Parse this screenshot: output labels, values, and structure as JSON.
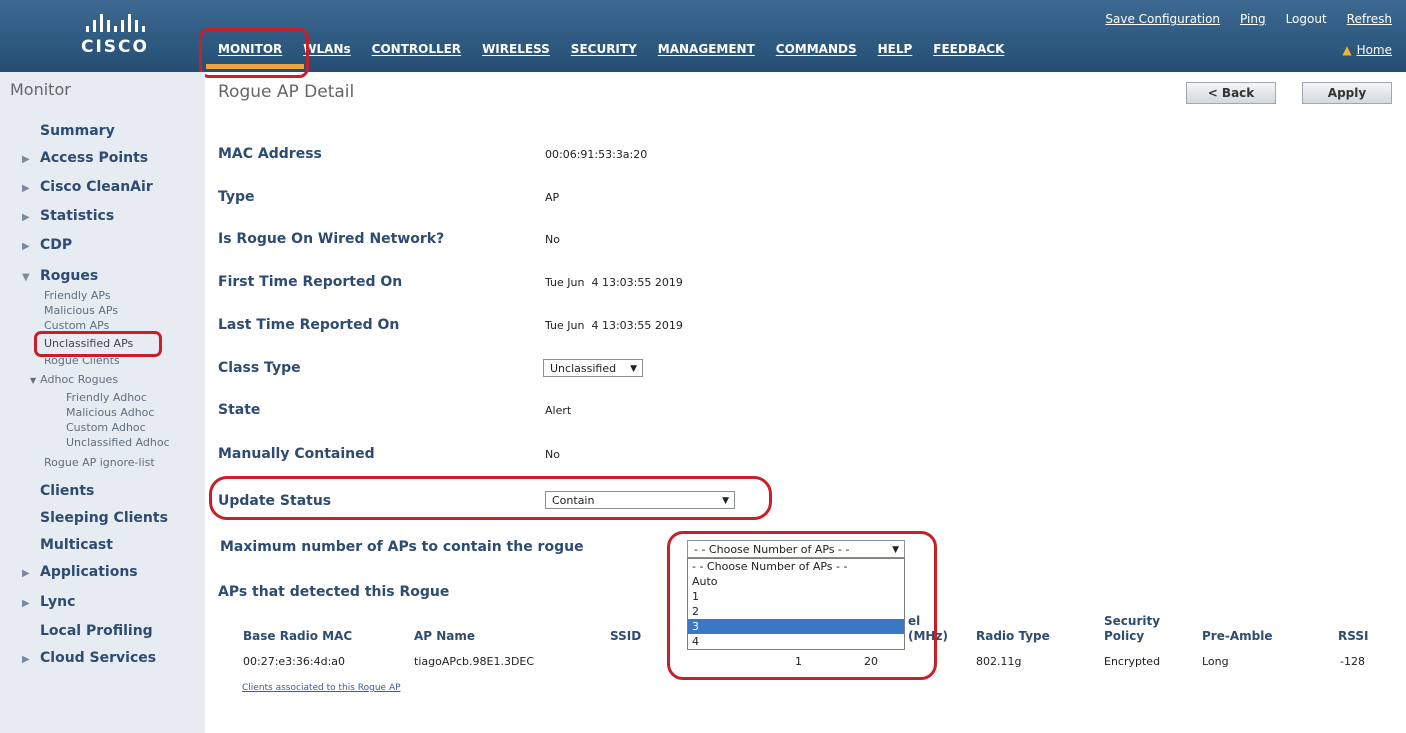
{
  "brand": {
    "logo_text": "CISCO"
  },
  "top_links": {
    "save": "Save Configuration",
    "ping": "Ping",
    "logout": "Logout",
    "refresh": "Refresh",
    "home": "Home"
  },
  "nav": [
    "MONITOR",
    "WLANs",
    "CONTROLLER",
    "WIRELESS",
    "SECURITY",
    "MANAGEMENT",
    "COMMANDS",
    "HELP",
    "FEEDBACK"
  ],
  "sidebar": {
    "title": "Monitor",
    "items": {
      "summary": "Summary",
      "access_points": "Access Points",
      "cleanair": "Cisco CleanAir",
      "statistics": "Statistics",
      "cdp": "CDP",
      "rogues": "Rogues",
      "friendly_aps": "Friendly APs",
      "malicious_aps": "Malicious APs",
      "custom_aps": "Custom APs",
      "unclassified_aps": "Unclassified APs",
      "rogue_clients": "Rogue Clients",
      "adhoc_rogues": "Adhoc Rogues",
      "friendly_adhoc": "Friendly Adhoc",
      "malicious_adhoc": "Malicious Adhoc",
      "custom_adhoc": "Custom Adhoc",
      "unclassified_adhoc": "Unclassified Adhoc",
      "ignore_list": "Rogue AP ignore-list",
      "clients": "Clients",
      "sleeping_clients": "Sleeping Clients",
      "multicast": "Multicast",
      "applications": "Applications",
      "lync": "Lync",
      "local_profiling": "Local Profiling",
      "cloud_services": "Cloud Services"
    }
  },
  "page": {
    "title": "Rogue AP Detail",
    "back_button": "< Back",
    "apply_button": "Apply"
  },
  "fields": {
    "mac_label": "MAC Address",
    "mac_value": "00:06:91:53:3a:20",
    "type_label": "Type",
    "type_value": "AP",
    "wired_label": "Is Rogue On Wired Network?",
    "wired_value": "No",
    "first_label": "First Time Reported On",
    "first_value": "Tue Jun  4 13:03:55 2019",
    "last_label": "Last Time Reported On",
    "last_value": "Tue Jun  4 13:03:55 2019",
    "class_label": "Class Type",
    "class_value": "Unclassified",
    "state_label": "State",
    "state_value": "Alert",
    "contained_label": "Manually Contained",
    "contained_value": "No",
    "update_label": "Update Status",
    "update_value": "Contain",
    "max_label": "Maximum number of APs to contain the rogue",
    "max_selected": "- - Choose Number of APs - -",
    "max_options": [
      "- - Choose Number of APs - -",
      "Auto",
      "1",
      "2",
      "3",
      "4"
    ],
    "max_highlighted": "3"
  },
  "detected": {
    "heading": "APs that detected this Rogue",
    "columns": {
      "base_mac": "Base Radio MAC",
      "ap_name": "AP Name",
      "ssid": "SSID",
      "channel_partial": "el",
      "width_partial": "(MHz)",
      "radio_type": "Radio Type",
      "security_l1": "Security",
      "security_l2": "Policy",
      "preamble": "Pre-Amble",
      "rssi": "RSSI"
    },
    "row": {
      "base_mac": "00:27:e3:36:4d:a0",
      "ap_name": "tiagoAPcb.98E1.3DEC",
      "channel": "1",
      "width": "20",
      "radio_type": "802.11g",
      "security": "Encrypted",
      "preamble": "Long",
      "rssi": "-128"
    },
    "clients_link": "Clients associated to this Rogue AP"
  },
  "colors": {
    "header": "#2f5b82",
    "sidebar": "#e6ecf2",
    "label": "#2e4c71",
    "highlight": "#c8202a",
    "accent": "#e8a63d"
  }
}
